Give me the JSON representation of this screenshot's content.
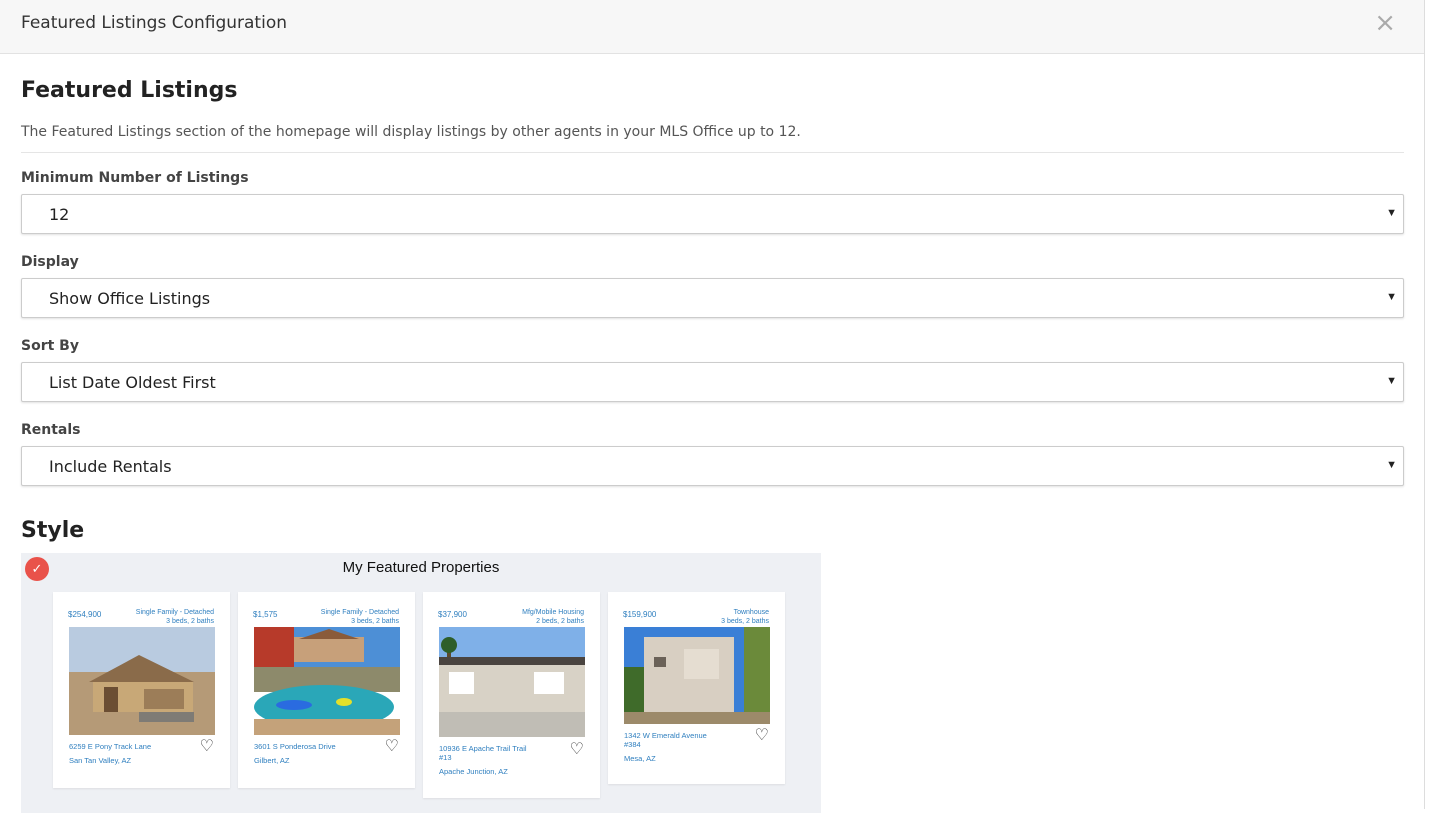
{
  "modal": {
    "title": "Featured Listings Configuration",
    "close_label": "×"
  },
  "section": {
    "title": "Featured Listings",
    "description": "The Featured Listings section of the homepage will display listings by other agents in your MLS Office up to 12."
  },
  "fields": [
    {
      "label": "Minimum Number of Listings",
      "value": "12"
    },
    {
      "label": "Display",
      "value": "Show Office Listings"
    },
    {
      "label": "Sort By",
      "value": "List Date Oldest First"
    },
    {
      "label": "Rentals",
      "value": "Include Rentals"
    }
  ],
  "style": {
    "title": "Style",
    "preview_title": "My Featured Properties",
    "selected_icon": "check-icon",
    "accent_color": "#e9524a",
    "link_color": "#2f7fbf",
    "cards": [
      {
        "price": "$254,900",
        "type": "Single Family - Detached",
        "beds": "3 beds, 2 baths",
        "address": "6259 E Pony Track Lane",
        "city": "San Tan Valley, AZ",
        "heart_icon": "heart-icon"
      },
      {
        "price": "$1,575",
        "type": "Single Family - Detached",
        "beds": "3 beds, 2 baths",
        "address": "3601 S Ponderosa Drive",
        "city": "Gilbert, AZ",
        "heart_icon": "heart-icon"
      },
      {
        "price": "$37,900",
        "type": "Mfg/Mobile Housing",
        "beds": "2 beds, 2 baths",
        "address": "10936 E Apache Trail Trail #13",
        "city": "Apache Junction, AZ",
        "heart_icon": "heart-icon"
      },
      {
        "price": "$159,900",
        "type": "Townhouse",
        "beds": "3 beds, 2 baths",
        "address": "1342 W Emerald Avenue #384",
        "city": "Mesa, AZ",
        "heart_icon": "heart-icon"
      }
    ]
  }
}
